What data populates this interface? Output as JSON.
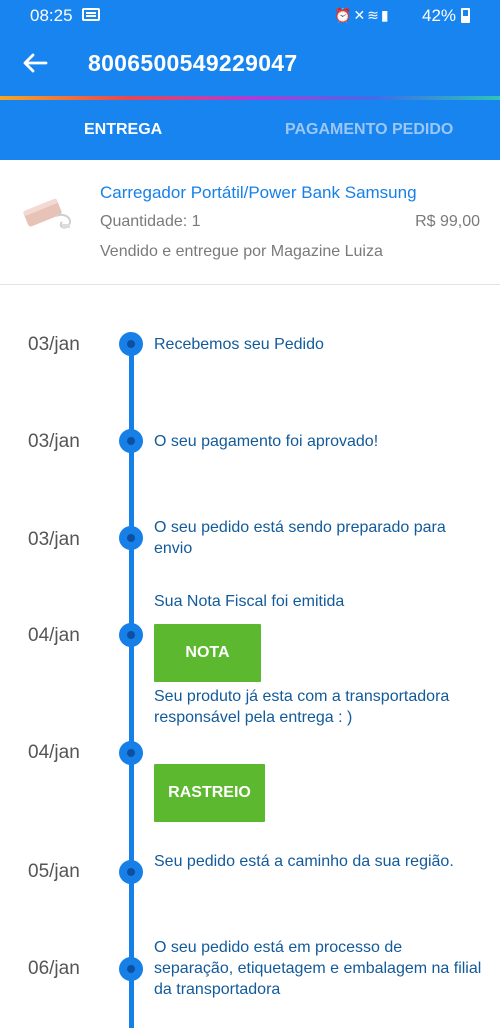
{
  "status_bar": {
    "time": "08:25",
    "battery": "42%",
    "icons": [
      "message-icon",
      "alarm-icon",
      "mute-icon",
      "wifi-icon",
      "signal-icon",
      "battery-icon"
    ]
  },
  "header": {
    "title": "8006500549229047",
    "back_icon": "back-arrow-icon"
  },
  "tabs": [
    {
      "label": "ENTREGA",
      "active": true
    },
    {
      "label": "PAGAMENTO PEDIDO",
      "active": false
    }
  ],
  "product": {
    "name": "Carregador Portátil/Power Bank Samsung",
    "quantity": "Quantidade: 1",
    "price": "R$ 99,00",
    "seller": "Vendido e entregue por Magazine Luiza"
  },
  "timeline": [
    {
      "date": "03/jan",
      "text": "Recebemos seu Pedido"
    },
    {
      "date": "03/jan",
      "text": "O seu pagamento foi aprovado!"
    },
    {
      "date": "03/jan",
      "text": "O seu pedido está sendo preparado para envio"
    },
    {
      "date": "04/jan",
      "text": "Sua Nota Fiscal foi emitida",
      "button": "NOTA"
    },
    {
      "date": "04/jan",
      "text": "Seu produto já esta com a transportadora responsável pela entrega : )",
      "button": "RASTREIO"
    },
    {
      "date": "05/jan",
      "text": "Seu pedido está a caminho da sua região."
    },
    {
      "date": "06/jan",
      "text": "O seu pedido está em processo de separação, etiquetagem e embalagem na filial da transportadora"
    }
  ],
  "colors": {
    "primary": "#1784f0",
    "timeline": "#1680e8",
    "button_green": "#5cb82e",
    "event_text": "#125a9a"
  }
}
